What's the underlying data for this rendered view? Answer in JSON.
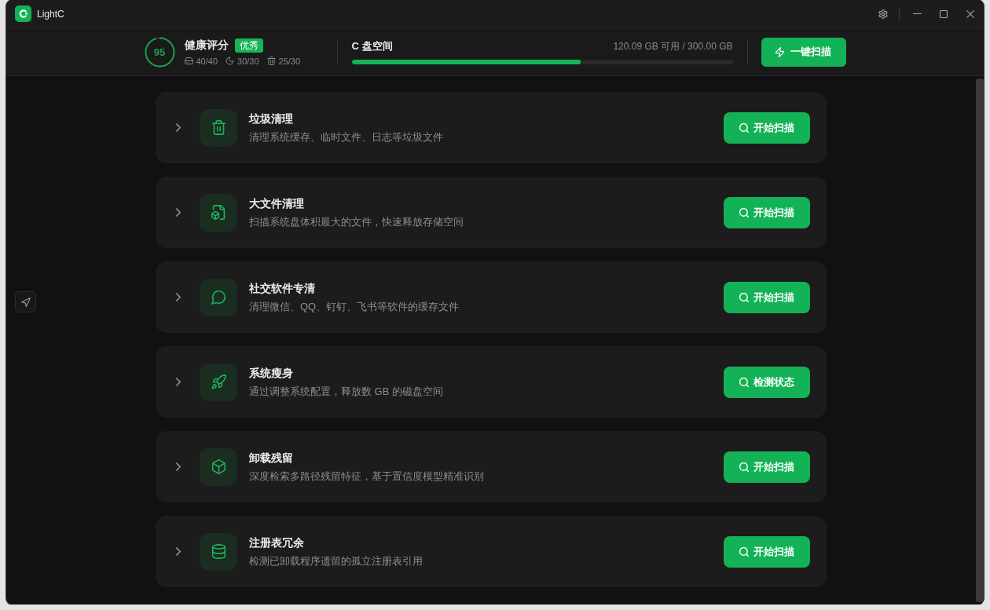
{
  "window": {
    "title": "LightC"
  },
  "header": {
    "health": {
      "score": "95",
      "level": 0.95,
      "label": "健康评分",
      "badge": "优秀",
      "stats": [
        {
          "kind": "drive",
          "value": "40/40"
        },
        {
          "kind": "moon",
          "value": "30/30"
        },
        {
          "kind": "trash",
          "value": "25/30"
        }
      ]
    },
    "disk": {
      "title": "C 盘空间",
      "usage": "120.09 GB 可用 / 300.00 GB",
      "level": 0.6
    },
    "scan_all_button": "一键扫描"
  },
  "tools": [
    {
      "kind": "trash",
      "title": "垃圾清理",
      "description": "清理系统缓存、临时文件、日志等垃圾文件",
      "button": "开始扫描",
      "expanded": false
    },
    {
      "kind": "file",
      "title": "大文件清理",
      "description": "扫描系统盘体积最大的文件，快速释放存储空间",
      "button": "开始扫描",
      "expanded": false
    },
    {
      "kind": "chat",
      "title": "社交软件专清",
      "description": "清理微信、QQ、钉钉、飞书等软件的缓存文件",
      "button": "开始扫描",
      "expanded": false
    },
    {
      "kind": "rocket",
      "title": "系统瘦身",
      "description": "通过调整系统配置，释放数 GB 的磁盘空间",
      "button": "检测状态",
      "expanded": false
    },
    {
      "kind": "cube",
      "title": "卸载残留",
      "description": "深度检索多路径残留特征，基于置信度模型精准识别",
      "button": "开始扫描",
      "expanded": false
    },
    {
      "kind": "database",
      "title": "注册表冗余",
      "description": "检测已卸载程序遗留的孤立注册表引用",
      "button": "开始扫描",
      "expanded": false
    }
  ]
}
